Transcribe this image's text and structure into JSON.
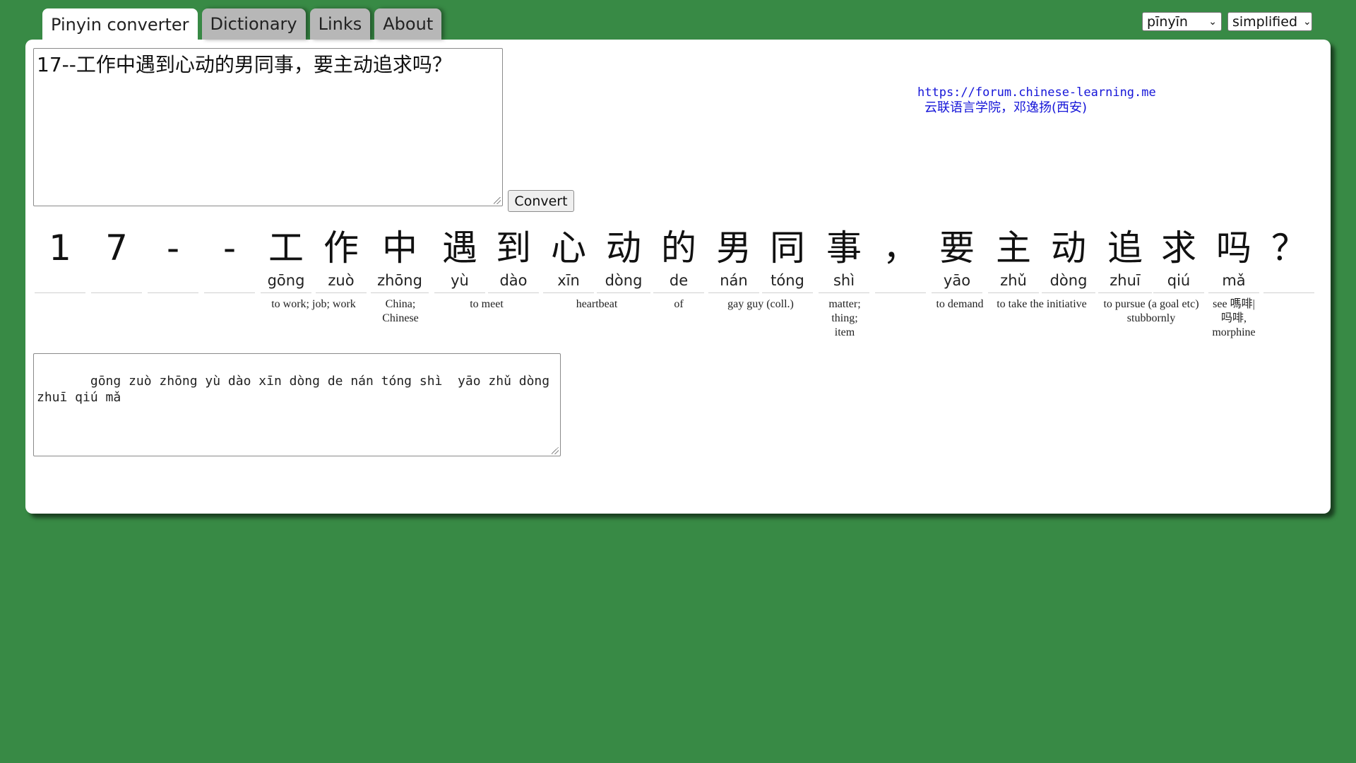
{
  "tabs": [
    {
      "label": "Pinyin converter",
      "active": true
    },
    {
      "label": "Dictionary",
      "active": false
    },
    {
      "label": "Links",
      "active": false
    },
    {
      "label": "About",
      "active": false
    }
  ],
  "selects": {
    "tone_mode": "pīnyīn",
    "script": "simplified"
  },
  "input": {
    "value": "17--工作中遇到心动的男同事，要主动追求吗？"
  },
  "convert_label": "Convert",
  "credit": {
    "url": "https://forum.chinese-learning.me",
    "author": "云联语言学院，邓逸扬(西安)"
  },
  "chars": [
    {
      "hz": "1",
      "py": ""
    },
    {
      "hz": "7",
      "py": ""
    },
    {
      "hz": "-",
      "py": ""
    },
    {
      "hz": "-",
      "py": ""
    },
    {
      "hz": "工",
      "py": "gōng"
    },
    {
      "hz": "作",
      "py": "zuò"
    },
    {
      "hz": "中",
      "py": "zhōng"
    },
    {
      "hz": "遇",
      "py": "yù"
    },
    {
      "hz": "到",
      "py": "dào"
    },
    {
      "hz": "心",
      "py": "xīn"
    },
    {
      "hz": "动",
      "py": "dòng"
    },
    {
      "hz": "的",
      "py": "de"
    },
    {
      "hz": "男",
      "py": "nán"
    },
    {
      "hz": "同",
      "py": "tóng"
    },
    {
      "hz": "事",
      "py": "shì"
    },
    {
      "hz": "，",
      "py": ""
    },
    {
      "hz": "要",
      "py": "yāo"
    },
    {
      "hz": "主",
      "py": "zhǔ"
    },
    {
      "hz": "动",
      "py": "dòng"
    },
    {
      "hz": "追",
      "py": "zhuī"
    },
    {
      "hz": "求",
      "py": "qiú"
    },
    {
      "hz": "吗",
      "py": "mǎ"
    },
    {
      "hz": "？",
      "py": ""
    }
  ],
  "definitions": [
    "to work; job; work",
    "China; Chinese",
    "to meet",
    "heartbeat",
    "of",
    "gay guy (coll.)",
    "matter; thing; item",
    "to demand",
    "to take the initiative",
    "to pursue (a goal etc) stubbornly",
    "see 嗎啡|吗啡, morphine"
  ],
  "output": {
    "value": "   gōng zuò zhōng yù dào xīn dòng de nán tóng shì  yāo zhǔ dòng zhuī qiú mǎ"
  }
}
